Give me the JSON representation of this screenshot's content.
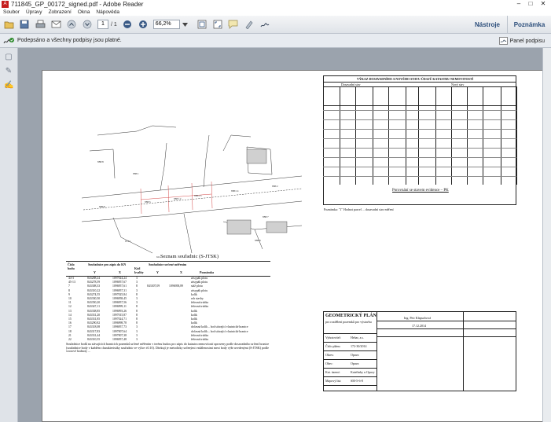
{
  "window": {
    "title": "711845_GP_00172_signed.pdf - Adobe Reader",
    "minimize": "–",
    "maximize": "□",
    "close": "✕"
  },
  "menu": [
    "Soubor",
    "Úpravy",
    "Zobrazení",
    "Okna",
    "Nápověda"
  ],
  "toolbar": {
    "page_current": "1",
    "page_total": "/ 1",
    "zoom_value": "66,2%",
    "tools_label": "Nástroje",
    "comments_label": "Poznámka"
  },
  "signature_bar": {
    "message": "Podepsáno a všechny podpisy jsou platné.",
    "panel_button": "Panel podpisu"
  },
  "document": {
    "coord_title": "Seznam souřadnic (S-JTSK)",
    "coord_headers": {
      "num": "Číslo bodu",
      "kn": "Souřadnice pro zápis do KN",
      "meas": "Souřadnice určené měřením",
      "y": "Y",
      "x": "X",
      "kod": "Kód kvality",
      "note": "Poznámka"
    },
    "coord_rows": [
      [
        "44-3",
        "843288,24",
        "1097024,24",
        "3",
        "",
        "",
        "zásypák plotu"
      ],
      [
        "45-13",
        "843278,59",
        "1096957,67",
        "3",
        "",
        "",
        "zásypák plotu"
      ],
      [
        "7",
        "843308,33",
        "1096957,61",
        "8",
        "843307,09",
        "1096958,89",
        "stáž plotu"
      ],
      [
        "8",
        "843310,22",
        "1096957,31",
        "3",
        "",
        "",
        "zásypák plotu"
      ],
      [
        "9",
        "843274,55",
        "1097025,84",
        "8",
        "",
        "",
        "kolík"
      ],
      [
        "10",
        "843330,50",
        "1096958,45",
        "3",
        "",
        "",
        "roh stavby"
      ],
      [
        "11",
        "843350,20",
        "1096957,56",
        "3",
        "",
        "",
        "železná trubka"
      ],
      [
        "12",
        "843347,11",
        "1096999,11",
        "8",
        "",
        "",
        "železná trubka"
      ],
      [
        "13",
        "843338,85",
        "1096993,26",
        "8",
        "",
        "",
        "kolík"
      ],
      [
        "14",
        "843331,20",
        "1097015,87",
        "8",
        "",
        "",
        "kolík"
      ],
      [
        "15",
        "843331,85",
        "1097024,71",
        "8",
        "",
        "",
        "kolík"
      ],
      [
        "16",
        "843290,82",
        "1096998,78",
        "8",
        "",
        "",
        "kolík"
      ],
      [
        "17",
        "843318,08",
        "1096957,73",
        "3",
        "",
        "",
        "dočasná kolík – bod stávající vlastnické hranice"
      ],
      [
        "18",
        "843317,83",
        "1097007,64",
        "3",
        "",
        "",
        "dočasná kolík – bod stávající vlastnické hranice"
      ],
      [
        "21",
        "843331,44",
        "1097007,38",
        "3",
        "",
        "",
        "železná trubka"
      ],
      [
        "22",
        "843310,55",
        "1096957,48",
        "3",
        "",
        "",
        "železná trubka"
      ]
    ],
    "coord_footnote": "Souřadnice bodů na stávajících hranicích pozemků určené měřením v terénu budou pro zápis do katastru nemovitostí upraveny podle dosavadního určení hranice (souřadnice body v každém charakteristiky souřadnic ve výšce ±0.10). Dávkují je metodicky určenými vzdálenostmi mezi body výše uvedenými (S-JTSK) podle vzorové hodnoty ...",
    "table_title": "VÝKAZ DOSAVADNÍHO A NOVÉHO STAVU ÚDAJŮ KATASTRU NEMOVITOSTÍ",
    "table_sub": [
      "Dosavadní stav",
      "Nový stav"
    ],
    "table_subhead": "Porovnání se stavem evidence – PK",
    "table_note": "Poznámka: \"1\" Hodnot parcel ... dosavadní stav měření",
    "gp_title": "GEOMETRICKÝ PLÁN",
    "gp_subtitle": "pro rozdělení pozemků pro výstavbu",
    "gp_rows": [
      [
        "Vyhotovitel:",
        "Hehar, a.s."
      ],
      [
        "Číslo plánu:",
        "172-30/2014"
      ],
      [
        "Okres:",
        "Opava"
      ],
      [
        "Obec:",
        "Opava"
      ],
      [
        "Kat. území:",
        "Kateřinky u Opavy"
      ],
      [
        "Mapový list:",
        "SM-5-6-8"
      ]
    ],
    "gp_stamp": [
      "Ing. Petr Klapuchová",
      "17.12.2014"
    ]
  },
  "colors": {
    "accent": "#2a4d7a",
    "ok": "#2e8b2e",
    "pdf": "#c51e1e"
  },
  "icons": [
    "adobe-reader-icon",
    "open-icon",
    "save-icon",
    "print-icon",
    "email-icon",
    "prev-page-icon",
    "next-page-icon",
    "zoom-out-icon",
    "zoom-in-icon",
    "fit-page-icon",
    "fullscreen-icon",
    "comment-icon",
    "highlight-icon",
    "sign-icon",
    "signature-ok-icon",
    "pages-panel-icon",
    "attachments-panel-icon",
    "signatures-panel-icon"
  ]
}
